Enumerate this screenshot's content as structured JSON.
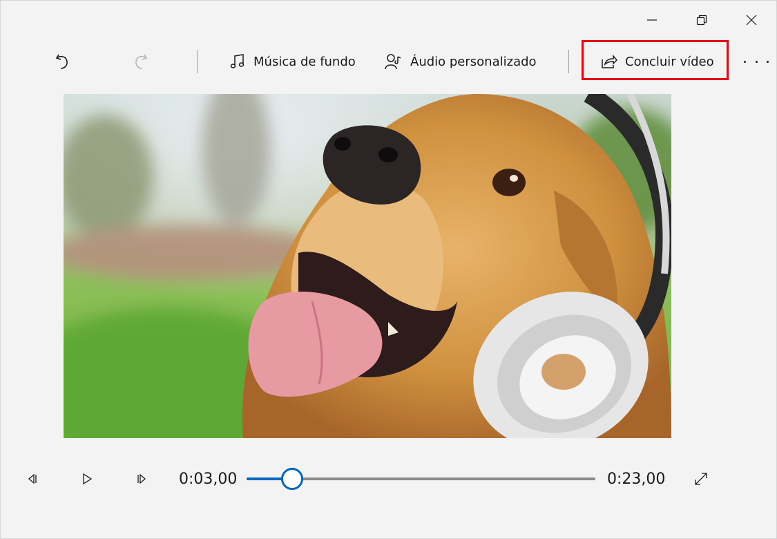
{
  "window": {
    "controls": {
      "minimize_icon": "minimize-icon",
      "restore_icon": "restore-icon",
      "close_icon": "close-icon"
    }
  },
  "toolbar": {
    "undo_icon": "undo-icon",
    "redo_icon": "redo-icon",
    "background_music_label": "Música de fundo",
    "custom_audio_label": "Áudio personalizado",
    "finish_video_label": "Concluir vídeo",
    "more_icon": "more-icon"
  },
  "preview": {
    "subject": "golden-retriever-with-headphones"
  },
  "playback": {
    "current_time": "0:03,00",
    "total_time": "0:23,00",
    "progress": 0.13
  },
  "colors": {
    "accent": "#0067c0",
    "highlight_border": "#e30613",
    "background": "#f3f3f3"
  }
}
